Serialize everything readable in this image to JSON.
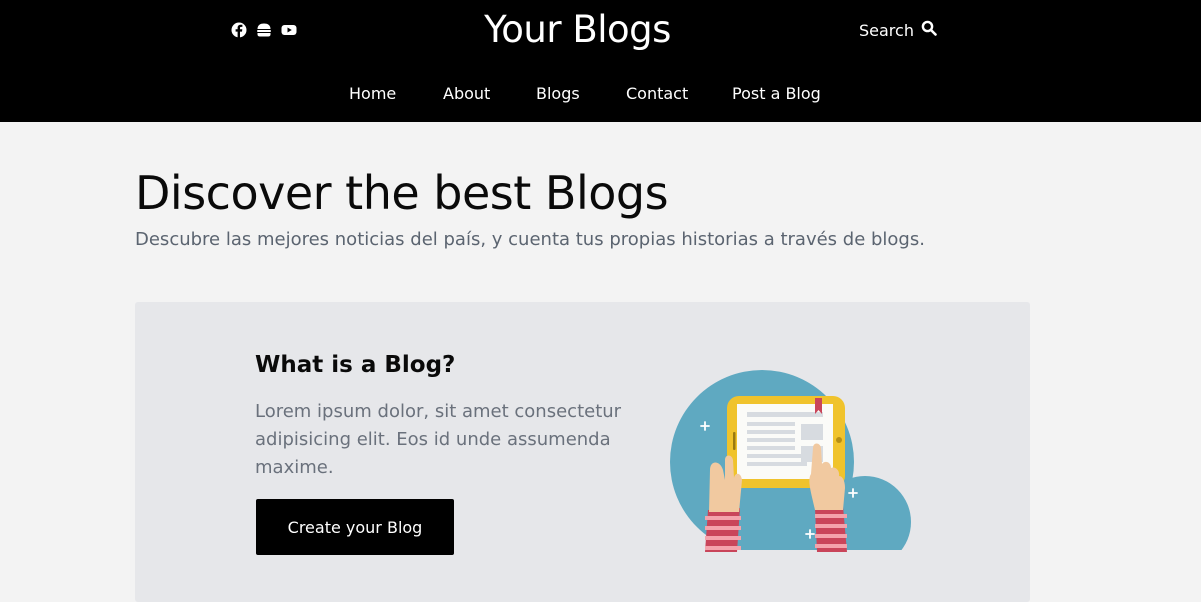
{
  "header": {
    "title": "Your Blogs",
    "search_label": "Search",
    "socials": [
      "facebook-icon",
      "burger-icon",
      "youtube-icon"
    ]
  },
  "nav": {
    "items": [
      "Home",
      "About",
      "Blogs",
      "Contact",
      "Post a Blog"
    ]
  },
  "hero": {
    "title": "Discover the best Blogs",
    "subtitle": "Descubre las mejores noticias del país, y cuenta tus propias historias a través de blogs."
  },
  "card": {
    "title": "What is a Blog?",
    "text": "Lorem ipsum dolor, sit amet consectetur adipisicing elit. Eos id unde assumenda maxime.",
    "button_label": "Create your Blog",
    "illustration": "hands-holding-tablet-illustration"
  },
  "colors": {
    "header_bg": "#000000",
    "page_bg": "#f3f3f3",
    "card_bg": "#e6e7ea",
    "button_bg": "#000000",
    "illustration_blue": "#5fa9c1",
    "tablet_yellow": "#f0c32c"
  }
}
